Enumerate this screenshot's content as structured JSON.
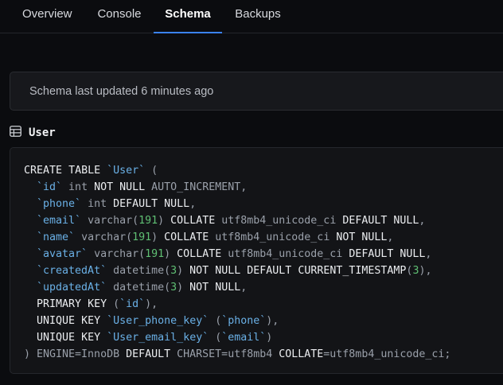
{
  "tabs": [
    {
      "label": "Overview",
      "active": false
    },
    {
      "label": "Console",
      "active": false
    },
    {
      "label": "Schema",
      "active": true
    },
    {
      "label": "Backups",
      "active": false
    }
  ],
  "status": {
    "text": "Schema last updated 6 minutes ago"
  },
  "table": {
    "name": "User",
    "icon": "table-icon"
  },
  "code_lines": [
    "CREATE TABLE `User` (",
    "  `id` int NOT NULL AUTO_INCREMENT,",
    "  `phone` int DEFAULT NULL,",
    "  `email` varchar(191) COLLATE utf8mb4_unicode_ci DEFAULT NULL,",
    "  `name` varchar(191) COLLATE utf8mb4_unicode_ci NOT NULL,",
    "  `avatar` varchar(191) COLLATE utf8mb4_unicode_ci DEFAULT NULL,",
    "  `createdAt` datetime(3) NOT NULL DEFAULT CURRENT_TIMESTAMP(3),",
    "  `updatedAt` datetime(3) NOT NULL,",
    "  PRIMARY KEY (`id`),",
    "  UNIQUE KEY `User_phone_key` (`phone`),",
    "  UNIQUE KEY `User_email_key` (`email`)",
    ") ENGINE=InnoDB DEFAULT CHARSET=utf8mb4 COLLATE=utf8mb4_unicode_ci;"
  ],
  "colors": {
    "accent": "#3b82f6",
    "identifier": "#6ab0e6",
    "number": "#5fbf73"
  }
}
